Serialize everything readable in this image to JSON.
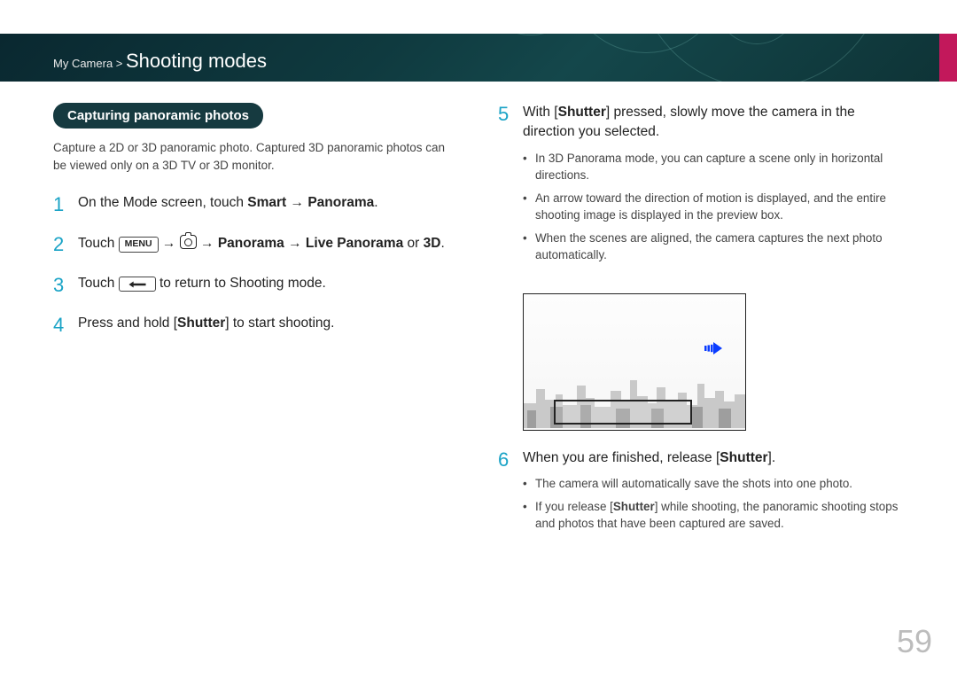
{
  "header": {
    "breadcrumb_prefix": "My Camera > ",
    "title": "Shooting modes"
  },
  "section_pill": "Capturing panoramic photos",
  "intro": "Capture a 2D or 3D panoramic photo. Captured 3D panoramic photos can be viewed only on a 3D TV or 3D monitor.",
  "steps": {
    "s1": {
      "num": "1",
      "pre": "On the Mode screen, touch ",
      "b1": "Smart",
      "arrow": " → ",
      "b2": "Panorama",
      "post": "."
    },
    "s2": {
      "num": "2",
      "pre": "Touch ",
      "menu_label": "MENU",
      "arrow": " → ",
      "b1": "Panorama",
      "b2": "Live Panorama",
      "or": " or ",
      "b3": "3D",
      "post": "."
    },
    "s3": {
      "num": "3",
      "pre": "Touch ",
      "post": " to return to Shooting mode."
    },
    "s4": {
      "num": "4",
      "pre": "Press and hold [",
      "b1": "Shutter",
      "post": "] to start shooting."
    },
    "s5": {
      "num": "5",
      "pre": "With [",
      "b1": "Shutter",
      "post": "] pressed, slowly move the camera in the direction you selected.",
      "bullets": [
        "In 3D Panorama mode, you can capture a scene only in horizontal directions.",
        "An arrow toward the direction of motion is displayed, and the entire shooting image is displayed in the preview box.",
        "When the scenes are aligned, the camera captures the next photo automatically."
      ]
    },
    "s6": {
      "num": "6",
      "pre": "When you are finished, release [",
      "b1": "Shutter",
      "post": "].",
      "bullets_a": "The camera will automatically save the shots into one photo.",
      "bullets_b_pre": "If you release [",
      "bullets_b_b": "Shutter",
      "bullets_b_post": "] while shooting, the panoramic shooting stops and photos that have been captured are saved."
    }
  },
  "page_number": "59"
}
